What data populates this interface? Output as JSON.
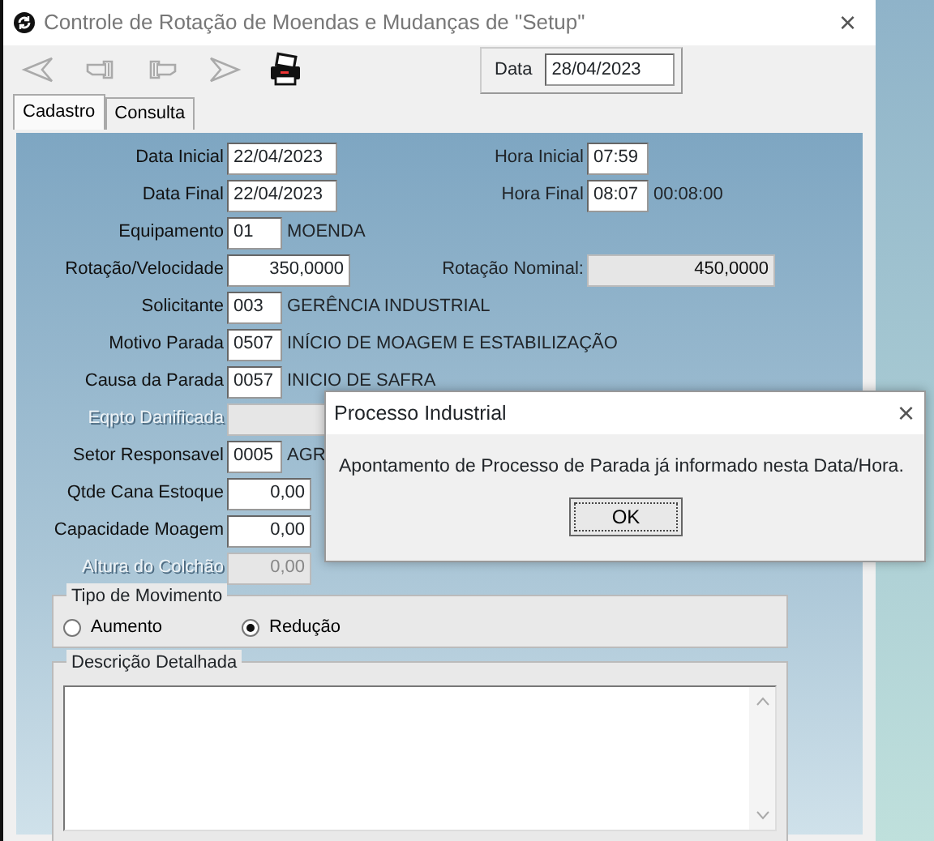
{
  "window": {
    "title": "Controle de Rotação de Moendas e Mudanças de \"Setup\"",
    "close": "×"
  },
  "toolbar": {
    "buttons": [
      {
        "kind": "first",
        "disabled": true
      },
      {
        "kind": "prev",
        "disabled": true
      },
      {
        "kind": "next",
        "disabled": true
      },
      {
        "kind": "last",
        "disabled": true
      },
      {
        "kind": "print",
        "disabled": false
      }
    ],
    "date_label": "Data",
    "date_value": "28/04/2023"
  },
  "tabs": [
    {
      "label": "Cadastro",
      "selected": true
    },
    {
      "label": "Consulta",
      "selected": false
    }
  ],
  "form": {
    "rows": [
      {
        "label": "Data Inicial",
        "disabled": false,
        "field": {
          "kind": "date",
          "value": "22/04/2023",
          "readonly": false
        },
        "right_label": "Hora Inicial",
        "right_field": {
          "kind": "time",
          "value": "07:59",
          "readonly": false
        }
      },
      {
        "label": "Data Final",
        "disabled": false,
        "field": {
          "kind": "date",
          "value": "22/04/2023",
          "readonly": false
        },
        "right_label": "Hora Final",
        "right_field": {
          "kind": "time",
          "value": "08:07",
          "readonly": false
        },
        "right_text": "00:08:00"
      },
      {
        "label": "Equipamento",
        "disabled": false,
        "field": {
          "kind": "code",
          "value": "01",
          "readonly": false
        },
        "text": "MOENDA"
      },
      {
        "label": "Rotação/Velocidade",
        "disabled": false,
        "field": {
          "kind": "number",
          "value": "350,0000",
          "readonly": false
        },
        "right_label": "Rotação Nominal:",
        "right_field": {
          "kind": "wide",
          "value": "450,0000",
          "readonly": true
        }
      },
      {
        "label": "Solicitante",
        "disabled": false,
        "field": {
          "kind": "code",
          "value": "003",
          "readonly": false
        },
        "text": "GERÊNCIA INDUSTRIAL"
      },
      {
        "label": "Motivo Parada",
        "disabled": false,
        "field": {
          "kind": "code",
          "value": "0507",
          "readonly": false
        },
        "text": "INÍCIO DE MOAGEM E ESTABILIZAÇÃO"
      },
      {
        "label": "Causa da Parada",
        "disabled": false,
        "field": {
          "kind": "code",
          "value": "0057",
          "readonly": false
        },
        "text": "INICIO DE SAFRA"
      },
      {
        "label": "Eqpto Danificada",
        "disabled": true,
        "field": {
          "kind": "long",
          "readonly": true
        }
      },
      {
        "label": "Setor Responsavel",
        "disabled": false,
        "field": {
          "kind": "code",
          "value": "0005",
          "readonly": false
        },
        "text": "AGR"
      },
      {
        "label": "Qtde Cana Estoque",
        "disabled": false,
        "field": {
          "kind": "amount",
          "value": "0,00",
          "readonly": false
        }
      },
      {
        "label": "Capacidade Moagem",
        "disabled": false,
        "field": {
          "kind": "amount",
          "value": "0,00",
          "readonly": false
        }
      },
      {
        "label": "Altura do Colchão",
        "disabled": true,
        "field": {
          "kind": "amount",
          "value": "0,00",
          "readonly": true
        }
      }
    ]
  },
  "movement": {
    "title": "Tipo de Movimento",
    "options": [
      {
        "label": "Aumento",
        "selected": false
      },
      {
        "label": "Redução",
        "selected": true
      }
    ]
  },
  "description": {
    "title": "Descrição Detalhada"
  },
  "dialog": {
    "title": "Processo Industrial",
    "close": "×",
    "message": "Apontamento de Processo de Parada já informado nesta Data/Hora.",
    "button": "OK"
  }
}
